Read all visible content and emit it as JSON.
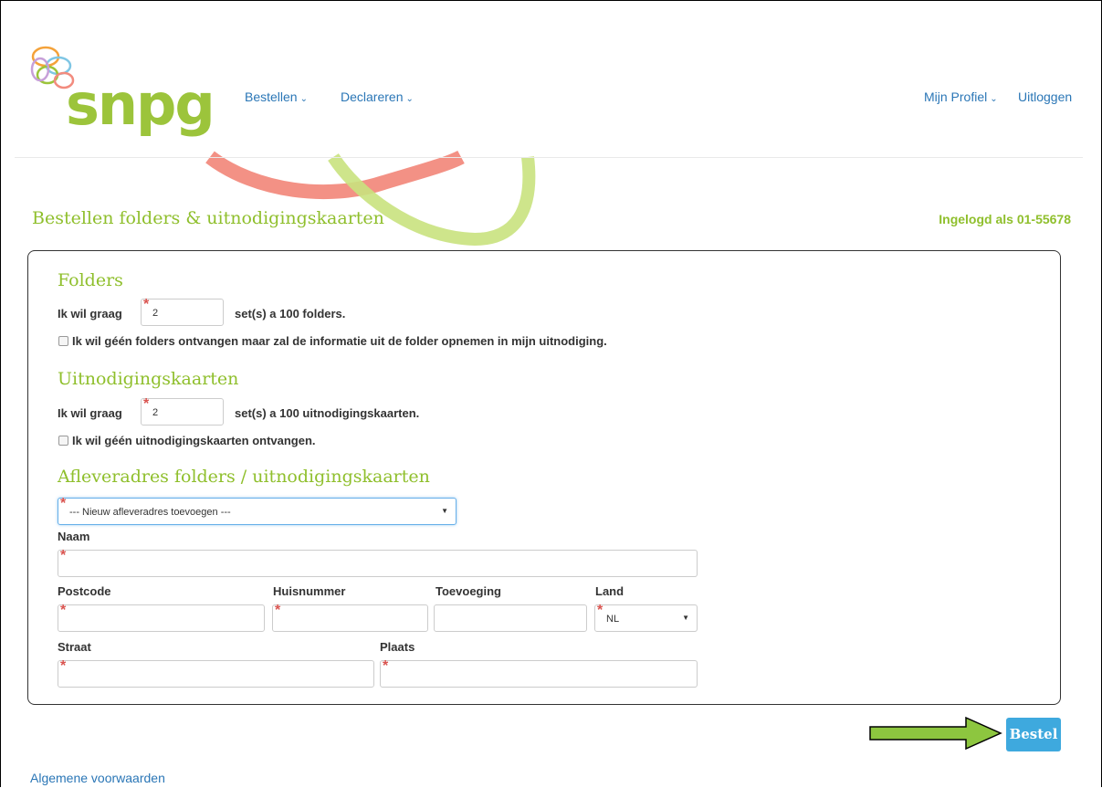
{
  "brand": {
    "logo_text": "snpg"
  },
  "nav": {
    "bestellen": "Bestellen",
    "declareren": "Declareren",
    "profiel": "Mijn Profiel",
    "uitloggen": "Uitloggen"
  },
  "page": {
    "title": "Bestellen folders & uitnodigingskaarten",
    "logged_in": "Ingelogd als 01-55678"
  },
  "folders": {
    "heading": "Folders",
    "label": "Ik wil graag",
    "value": "2",
    "suffix": "set(s) a 100 folders.",
    "checkbox_label": "Ik wil géén folders ontvangen maar zal de informatie uit de folder opnemen in mijn uitnodiging."
  },
  "kaarten": {
    "heading": "Uitnodigingskaarten",
    "label": "Ik wil graag",
    "value": "2",
    "suffix": "set(s) a 100 uitnodigingskaarten.",
    "checkbox_label": "Ik wil géén uitnodigingskaarten ontvangen."
  },
  "adres": {
    "heading": "Afleveradres folders / uitnodigingskaarten",
    "select_value": "--- Nieuw afleveradres toevoegen ---",
    "naam": "Naam",
    "postcode": "Postcode",
    "huisnummer": "Huisnummer",
    "toevoeging": "Toevoeging",
    "land": "Land",
    "land_value": "NL",
    "straat": "Straat",
    "plaats": "Plaats"
  },
  "actions": {
    "bestel": "Bestel"
  },
  "footer": {
    "voorwaarden": "Algemene voorwaarden"
  },
  "colors": {
    "brand_green": "#9cc43b",
    "link_blue": "#2a76b6",
    "button_blue": "#3ea9de",
    "arrow_green": "#8dc63f"
  }
}
